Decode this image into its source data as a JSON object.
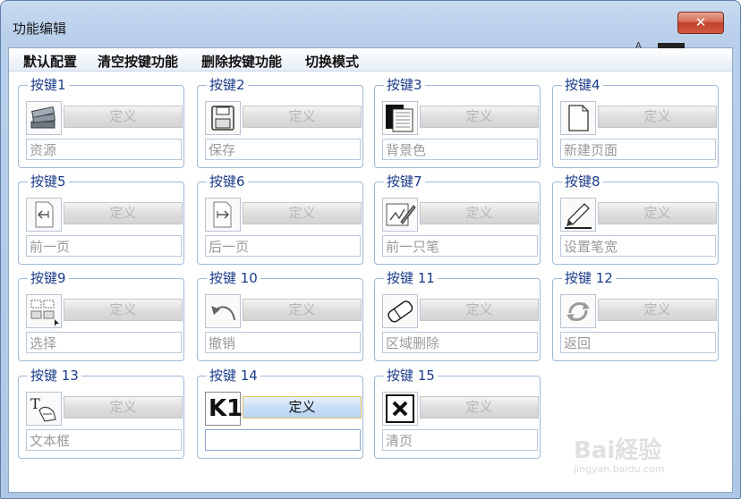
{
  "window": {
    "title": "功能编辑",
    "close_glyph": "✕"
  },
  "menu": [
    "默认配置",
    "清空按键功能",
    "删除按键功能",
    "切换模式"
  ],
  "define_label": "定义",
  "groups": [
    {
      "title": "按键1",
      "icon": "books-icon",
      "name": "资源",
      "active": false
    },
    {
      "title": "按键2",
      "icon": "save-icon",
      "name": "保存",
      "active": false
    },
    {
      "title": "按键3",
      "icon": "background-color-icon",
      "name": "背景色",
      "active": false
    },
    {
      "title": "按键4",
      "icon": "new-page-icon",
      "name": "新建页面",
      "active": false
    },
    {
      "title": "按键5",
      "icon": "previous-page-icon",
      "name": "前一页",
      "active": false
    },
    {
      "title": "按键6",
      "icon": "next-page-icon",
      "name": "后一页",
      "active": false
    },
    {
      "title": "按键7",
      "icon": "previous-pen-icon",
      "name": "前一只笔",
      "active": false
    },
    {
      "title": "按键8",
      "icon": "pen-width-icon",
      "name": "设置笔宽",
      "active": false
    },
    {
      "title": "按键9",
      "icon": "select-icon",
      "name": "选择",
      "active": false
    },
    {
      "title": "按键 10",
      "icon": "undo-icon",
      "name": "撤销",
      "active": false
    },
    {
      "title": "按键 11",
      "icon": "eraser-icon",
      "name": "区域删除",
      "active": false
    },
    {
      "title": "按键 12",
      "icon": "return-icon",
      "name": "返回",
      "active": false
    },
    {
      "title": "按键 13",
      "icon": "textbox-icon",
      "name": "文本框",
      "active": false
    },
    {
      "title": "按键 14",
      "icon": "k1-icon",
      "icon_text": "K1",
      "name": "",
      "active": true
    },
    {
      "title": "按键 15",
      "icon": "clear-page-icon",
      "name": "清页",
      "active": false
    }
  ],
  "watermark": {
    "text": "Bai経验",
    "sub": "jingyan.baidu.com"
  }
}
